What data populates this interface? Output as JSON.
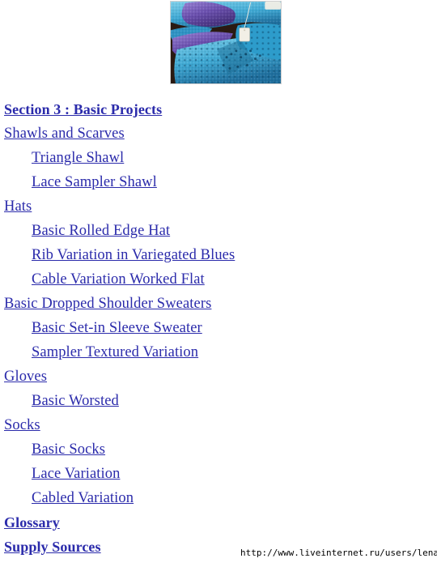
{
  "photo": {
    "alt": "Knitted blue and purple lace shawls with a paper price tag",
    "colors": {
      "teal": "#3fa9d4",
      "teal_dark": "#1f6f9e",
      "teal_light": "#7fd0ea",
      "purple": "#6a4fae",
      "purple_light": "#8f78c9",
      "purple_dark": "#4a3580",
      "background_dark": "#2a1a12",
      "tag": "#f2efe6",
      "border": "#cfcfcf"
    }
  },
  "theme": {
    "link_color": "#2b2bab",
    "page_background": "#ffffff",
    "footer_text_color": "#000000"
  },
  "toc": {
    "items": [
      {
        "label": "Section 3 : Basic Projects",
        "indent": false,
        "bold": true
      },
      {
        "label": "Shawls and Scarves",
        "indent": false,
        "bold": false
      },
      {
        "label": "Triangle Shawl",
        "indent": true,
        "bold": false
      },
      {
        "label": "Lace Sampler Shawl",
        "indent": true,
        "bold": false
      },
      {
        "label": "Hats",
        "indent": false,
        "bold": false
      },
      {
        "label": "Basic Rolled Edge Hat",
        "indent": true,
        "bold": false
      },
      {
        "label": "Rib Variation in Variegated Blues",
        "indent": true,
        "bold": false
      },
      {
        "label": "Cable Variation Worked Flat",
        "indent": true,
        "bold": false
      },
      {
        "label": "Basic Dropped Shoulder Sweaters",
        "indent": false,
        "bold": false
      },
      {
        "label": "Basic Set-in Sleeve Sweater",
        "indent": true,
        "bold": false
      },
      {
        "label": "Sampler Textured Variation",
        "indent": true,
        "bold": false
      },
      {
        "label": "Gloves",
        "indent": false,
        "bold": false
      },
      {
        "label": "Basic Worsted",
        "indent": true,
        "bold": false
      },
      {
        "label": "Socks",
        "indent": false,
        "bold": false
      },
      {
        "label": "Basic Socks",
        "indent": true,
        "bold": false
      },
      {
        "label": "Lace Variation",
        "indent": true,
        "bold": false
      },
      {
        "label": "Cabled Variation",
        "indent": true,
        "bold": false
      },
      {
        "label": "Glossary",
        "indent": false,
        "bold": true
      },
      {
        "label": "Supply Sources",
        "indent": false,
        "bold": true
      }
    ]
  },
  "footer": {
    "url": "http://www.liveinternet.ru/users/lenatt/"
  }
}
